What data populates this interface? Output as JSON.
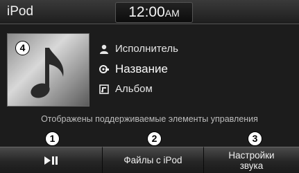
{
  "header": {
    "app_title": "iPod",
    "clock_time": "12:00",
    "clock_ampm": "AM"
  },
  "now_playing": {
    "artist": "Исполнитель",
    "title": "Название",
    "album": "Альбом"
  },
  "hint_text": "Отображены поддерживаемые элементы управления",
  "buttons": {
    "play_pause_icon": "play-pause-icon",
    "files_label": "Файлы с iPod",
    "sound_label_line1": "Настройки",
    "sound_label_line2": "звука"
  },
  "callouts": {
    "play": "1",
    "files": "2",
    "sound": "3",
    "album_art": "4"
  }
}
